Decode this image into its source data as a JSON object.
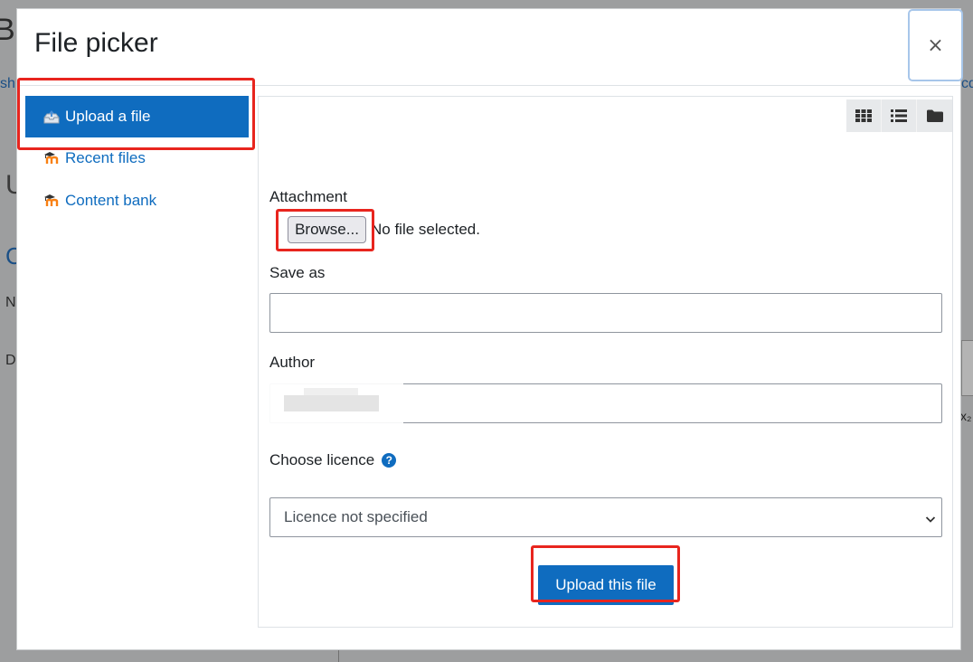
{
  "background": {
    "frag_left_top": "Bo",
    "frag_left_link": "sh",
    "frag_right_link": "cd",
    "frag_u": "U",
    "frag_c": "C",
    "frag_n": "N",
    "frag_d": "D",
    "frag_right_small": "x₂"
  },
  "modal": {
    "title": "File picker",
    "close_label": "×"
  },
  "sidebar": {
    "items": [
      {
        "label": "Upload a file",
        "icon": "upload-icon",
        "active": true
      },
      {
        "label": "Recent files",
        "icon": "moodle-icon",
        "active": false
      },
      {
        "label": "Content bank",
        "icon": "moodle-icon",
        "active": false
      }
    ]
  },
  "viewbar": {
    "buttons": [
      "grid-view-icon",
      "list-view-icon",
      "folder-view-icon"
    ]
  },
  "form": {
    "attachment_label": "Attachment",
    "browse_label": "Browse...",
    "no_file_text": "No file selected.",
    "save_as_label": "Save as",
    "save_as_value": "",
    "author_label": "Author",
    "licence_label": "Choose licence",
    "licence_help": "?",
    "licence_selected": "Licence not specified",
    "upload_label": "Upload this file"
  },
  "colors": {
    "primary": "#0f6cbf",
    "highlight": "#e8251e"
  }
}
